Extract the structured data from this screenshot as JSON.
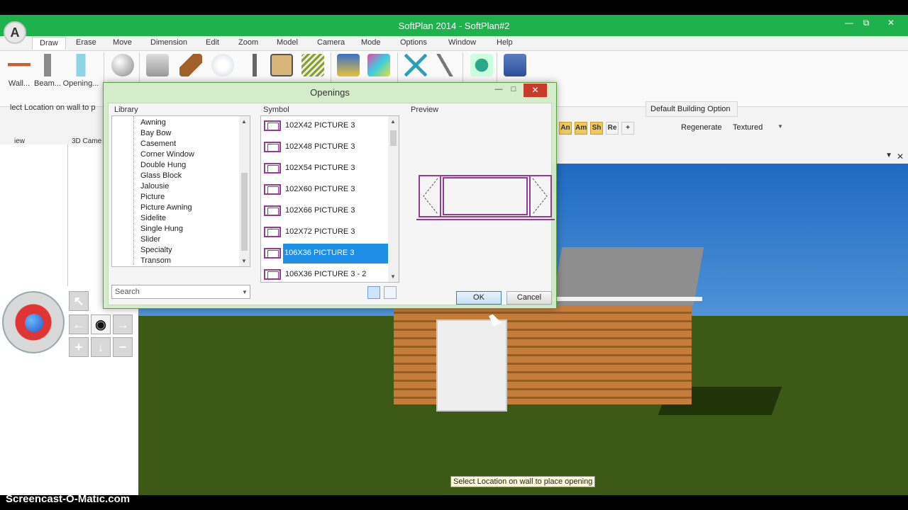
{
  "window": {
    "title": "SoftPlan 2014 - SoftPlan#2",
    "minimize": "—",
    "restore": "⧉",
    "close": "✕",
    "logo": "A"
  },
  "menu": [
    "Draw",
    "Erase",
    "Move",
    "Dimension",
    "Edit",
    "Zoom",
    "Model",
    "Camera",
    "Mode",
    "Options",
    "Window",
    "Help"
  ],
  "ribbon": {
    "tools": [
      "Wall...",
      "Beam...",
      "Opening..."
    ],
    "icons": [
      "wall-icon",
      "beam-icon",
      "opening-icon",
      "solid-icon",
      "symbol-icon",
      "stair-icon",
      "electrical-icon",
      "post-icon",
      "cabinet-icon",
      "deck-icon",
      "ceiling-icon",
      "floor-icon",
      "interior-icon",
      "profile-icon",
      "site-icon",
      "roof-icon"
    ]
  },
  "command_prompt": "lect Location on wall to p",
  "default_building_option": "Default Building Option",
  "option_bar": {
    "buttons": [
      "An",
      "Am",
      "Sh",
      "Re"
    ],
    "regenerate": "Regenerate",
    "render_mode": "Textured"
  },
  "panel_tabs": {
    "view": "iew",
    "camera": "3D Came"
  },
  "dialog": {
    "title": "Openings",
    "library_label": "Library",
    "symbol_label": "Symbol",
    "preview_label": "Preview",
    "library_items": [
      "Awning",
      "Bay Bow",
      "Casement",
      "Corner Window",
      "Double Hung",
      "Glass Block",
      "Jalousie",
      "Picture",
      "Picture Awning",
      "Sidelite",
      "Single Hung",
      "Slider",
      "Specialty",
      "Transom"
    ],
    "symbols": [
      "102X42 PICTURE 3",
      "102X48 PICTURE 3",
      "102X54 PICTURE 3",
      "102X60 PICTURE 3",
      "102X66 PICTURE 3",
      "102X72 PICTURE 3",
      "106X36 PICTURE 3",
      "106X36 PICTURE 3 - 2"
    ],
    "selected_symbol": "106X36 PICTURE 3",
    "search_placeholder": "Search",
    "ok": "OK",
    "cancel": "Cancel",
    "close": "✕",
    "minimize": "—",
    "maximize": "□"
  },
  "status_tooltip": "Select Location on wall to place opening",
  "watermark": "Screencast-O-Matic.com",
  "colors": {
    "titlebar": "#1fb14b",
    "selection": "#1e8fe8",
    "symbol_stroke": "#8e3f8e",
    "dialog_close": "#c83a2a"
  }
}
